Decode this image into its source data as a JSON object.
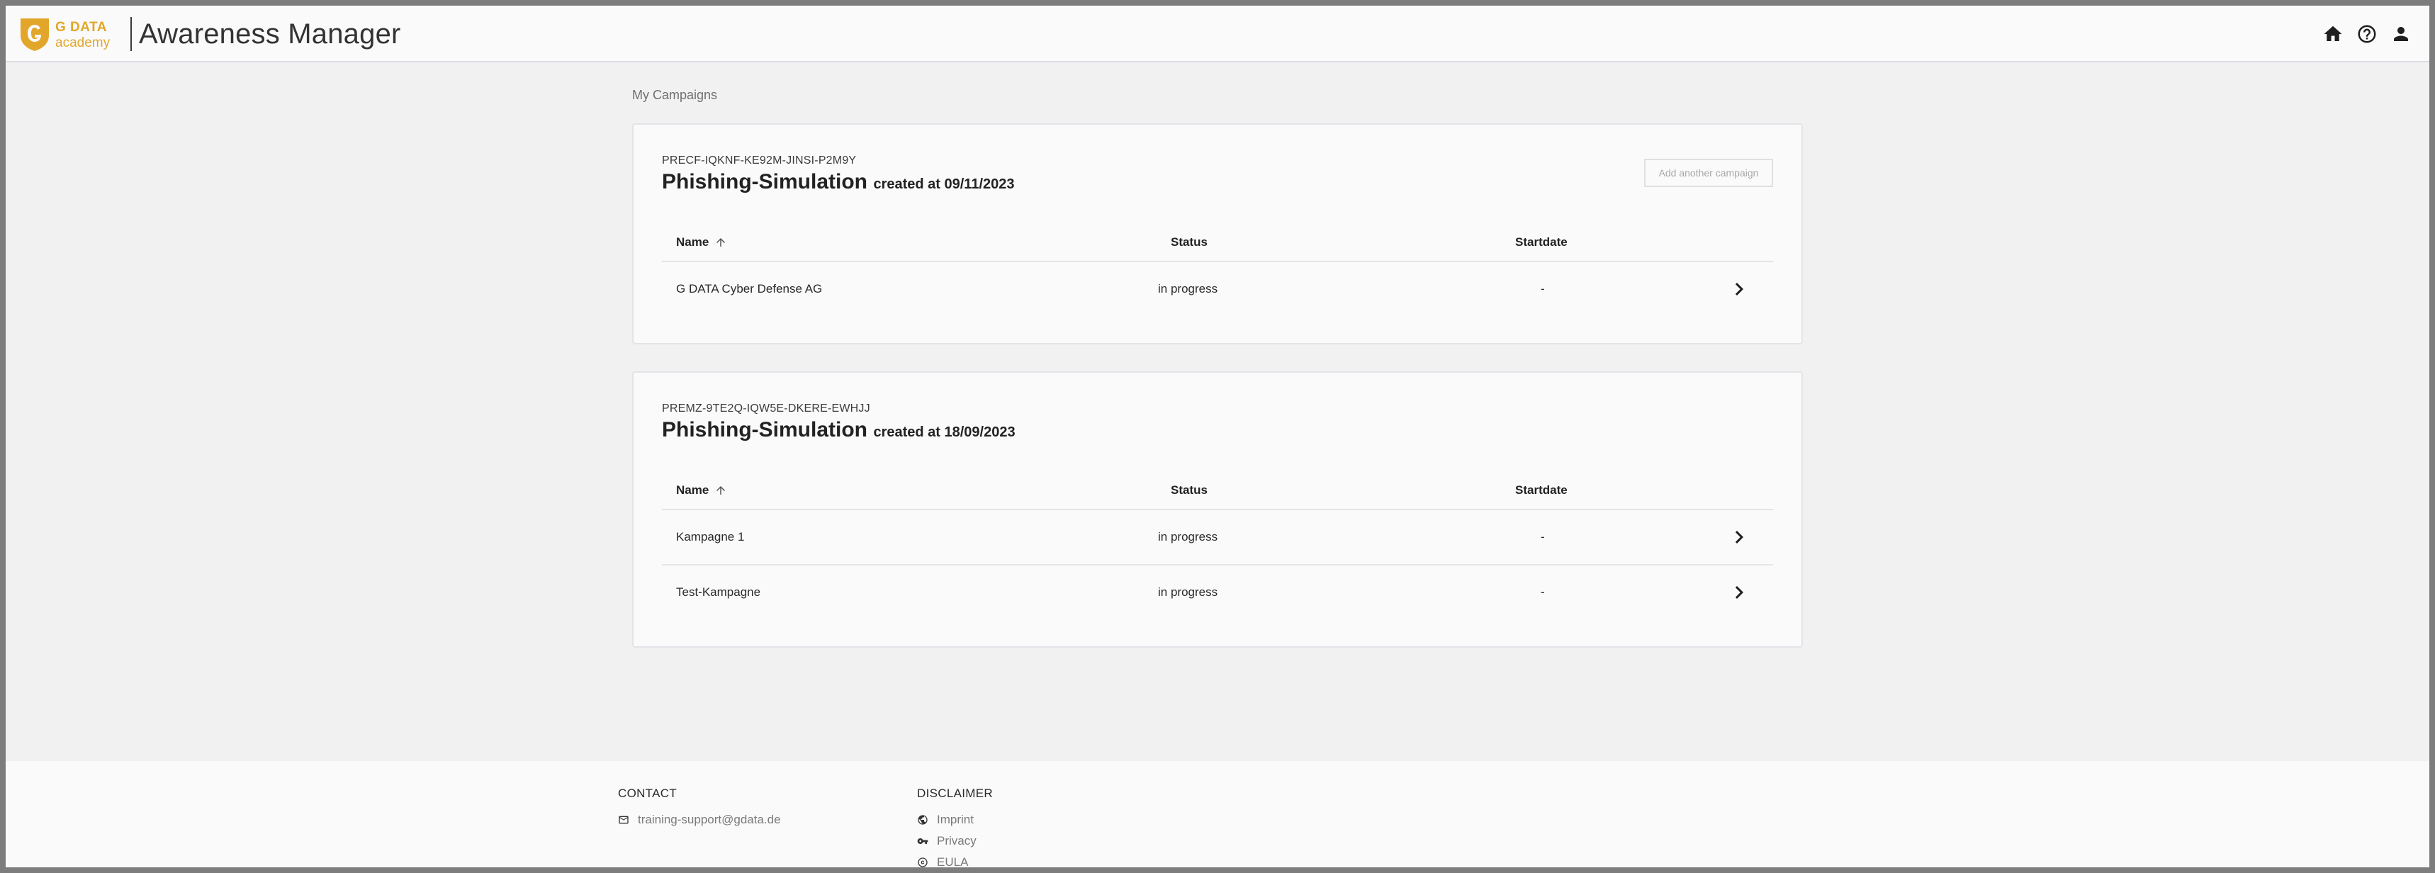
{
  "header": {
    "logo_line1": "G DATA",
    "logo_line2": "academy",
    "app_title": "Awareness Manager",
    "icons": [
      "home-icon",
      "help-icon",
      "account-icon"
    ]
  },
  "breadcrumb": "My Campaigns",
  "columns": {
    "name": "Name",
    "status": "Status",
    "startdate": "Startdate"
  },
  "campaigns": [
    {
      "code": "PRECF-IQKNF-KE92M-JINSI-P2M9Y",
      "title": "Phishing-Simulation",
      "created": "created at 09/11/2023",
      "add_button": "Add another campaign",
      "rows": [
        {
          "name": "G DATA Cyber Defense AG",
          "status": "in progress",
          "startdate": "-"
        }
      ]
    },
    {
      "code": "PREMZ-9TE2Q-IQW5E-DKERE-EWHJJ",
      "title": "Phishing-Simulation",
      "created": "created at 18/09/2023",
      "rows": [
        {
          "name": "Kampagne 1",
          "status": "in progress",
          "startdate": "-"
        },
        {
          "name": "Test-Kampagne",
          "status": "in progress",
          "startdate": "-"
        }
      ]
    }
  ],
  "footer": {
    "contact_heading": "CONTACT",
    "contact_email": "training-support@gdata.de",
    "disclaimer_heading": "DISCLAIMER",
    "links": [
      "Imprint",
      "Privacy",
      "EULA"
    ]
  },
  "colors": {
    "brand": "#e2a62b",
    "background": "#f1f1f2",
    "card": "#fafafa"
  }
}
